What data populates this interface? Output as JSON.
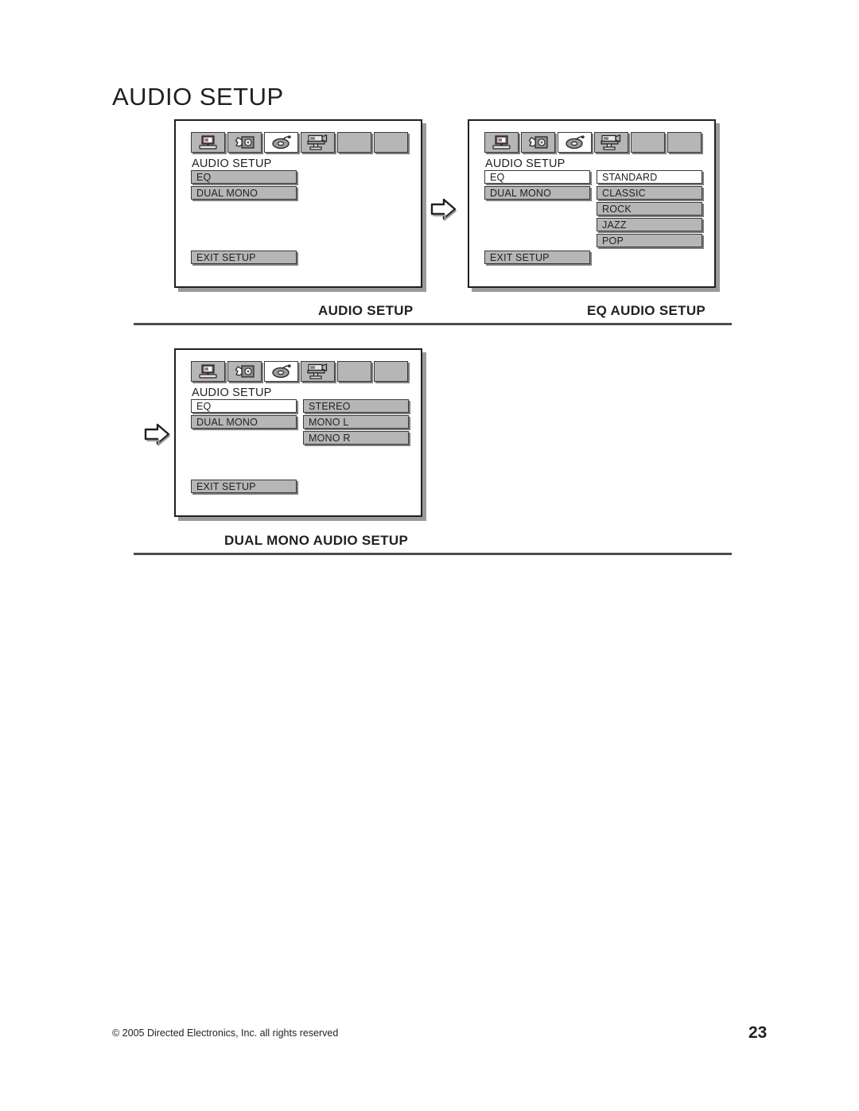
{
  "page": {
    "title": "AUDIO SETUP",
    "number": "23",
    "copyright": "© 2005 Directed Electronics, Inc. all rights reserved"
  },
  "icons": {
    "tab1": "monitor-icon",
    "tab2": "speaker-icon",
    "tab3": "disc-icon",
    "tab4": "camcorder-icon",
    "tab5": "blank-tab-icon",
    "tab6": "blank-tab-icon",
    "flow": "right-arrow-icon"
  },
  "colors": {
    "menu_item_bg": "#b6b6b6",
    "menu_item_selected_bg": "#ffffff",
    "panel_border": "#231f20",
    "shadow": "#9a9a9a",
    "text": "#231f20"
  },
  "panels": [
    {
      "id": "audio-setup",
      "heading": "AUDIO SETUP",
      "left_items": [
        {
          "label": "EQ",
          "selected": false
        },
        {
          "label": "DUAL MONO",
          "selected": false
        }
      ],
      "right_items": [],
      "exit_label": "EXIT SETUP",
      "caption": "AUDIO SETUP"
    },
    {
      "id": "eq-audio-setup",
      "heading": "AUDIO SETUP",
      "left_items": [
        {
          "label": "EQ",
          "selected": true
        },
        {
          "label": "DUAL MONO",
          "selected": false
        }
      ],
      "right_items": [
        {
          "label": "STANDARD",
          "selected": true
        },
        {
          "label": "CLASSIC",
          "selected": false
        },
        {
          "label": "ROCK",
          "selected": false
        },
        {
          "label": "JAZZ",
          "selected": false
        },
        {
          "label": "POP",
          "selected": false
        }
      ],
      "exit_label": "EXIT SETUP",
      "caption": "EQ AUDIO SETUP"
    },
    {
      "id": "dual-mono-audio-setup",
      "heading": "AUDIO SETUP",
      "left_items": [
        {
          "label": "EQ",
          "selected": true
        },
        {
          "label": "DUAL MONO",
          "selected": false
        }
      ],
      "right_items": [
        {
          "label": "STEREO",
          "selected": false
        },
        {
          "label": "MONO L",
          "selected": false
        },
        {
          "label": "MONO R",
          "selected": false
        }
      ],
      "exit_label": "EXIT SETUP",
      "caption": "DUAL MONO AUDIO SETUP"
    }
  ]
}
